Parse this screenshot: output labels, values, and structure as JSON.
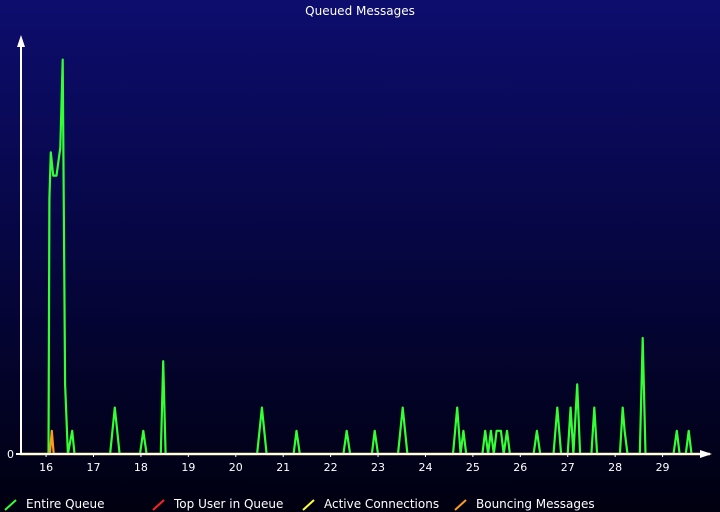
{
  "chart_data": {
    "type": "line",
    "title": "Queued Messages",
    "xlabel": "",
    "ylabel": "",
    "x_ticks": [
      "16",
      "17",
      "18",
      "19",
      "20",
      "21",
      "22",
      "23",
      "24",
      "25",
      "26",
      "27",
      "28",
      "29"
    ],
    "y_ticks": [
      "0"
    ],
    "xlim": [
      15.45,
      30.0
    ],
    "ylim": [
      0,
      17.5
    ],
    "grid": false,
    "legend": "bottom",
    "series": [
      {
        "name": "Entire Queue",
        "color": "#33ff33",
        "points": [
          [
            15.45,
            0
          ],
          [
            16.05,
            0
          ],
          [
            16.07,
            11
          ],
          [
            16.1,
            13
          ],
          [
            16.15,
            12
          ],
          [
            16.22,
            12
          ],
          [
            16.3,
            13.2
          ],
          [
            16.35,
            17
          ],
          [
            16.4,
            3
          ],
          [
            16.46,
            0
          ],
          [
            16.55,
            1
          ],
          [
            16.6,
            0
          ],
          [
            17.35,
            0
          ],
          [
            17.45,
            2
          ],
          [
            17.55,
            0
          ],
          [
            17.98,
            0
          ],
          [
            18.05,
            1
          ],
          [
            18.12,
            0
          ],
          [
            18.42,
            0
          ],
          [
            18.47,
            4
          ],
          [
            18.52,
            0
          ],
          [
            20.45,
            0
          ],
          [
            20.55,
            2
          ],
          [
            20.65,
            0
          ],
          [
            21.22,
            0
          ],
          [
            21.28,
            1
          ],
          [
            21.35,
            0
          ],
          [
            22.27,
            0
          ],
          [
            22.34,
            1
          ],
          [
            22.41,
            0
          ],
          [
            22.87,
            0
          ],
          [
            22.93,
            1
          ],
          [
            23.0,
            0
          ],
          [
            23.42,
            0
          ],
          [
            23.52,
            2
          ],
          [
            23.62,
            0
          ],
          [
            24.58,
            0
          ],
          [
            24.67,
            2
          ],
          [
            24.74,
            0
          ],
          [
            24.8,
            1
          ],
          [
            24.86,
            0
          ],
          [
            25.2,
            0
          ],
          [
            25.26,
            1
          ],
          [
            25.32,
            0
          ],
          [
            25.38,
            1
          ],
          [
            25.44,
            0
          ],
          [
            25.5,
            1
          ],
          [
            25.59,
            1
          ],
          [
            25.65,
            0
          ],
          [
            25.72,
            1
          ],
          [
            25.78,
            0
          ],
          [
            26.28,
            0
          ],
          [
            26.35,
            1
          ],
          [
            26.42,
            0
          ],
          [
            26.7,
            0
          ],
          [
            26.78,
            2
          ],
          [
            26.86,
            0
          ],
          [
            27.0,
            0
          ],
          [
            27.06,
            2
          ],
          [
            27.12,
            0
          ],
          [
            27.2,
            3
          ],
          [
            27.26,
            0
          ],
          [
            27.5,
            0
          ],
          [
            27.56,
            2
          ],
          [
            27.62,
            0
          ],
          [
            28.1,
            0
          ],
          [
            28.16,
            2
          ],
          [
            28.2,
            1
          ],
          [
            28.26,
            0
          ],
          [
            28.52,
            0
          ],
          [
            28.58,
            5
          ],
          [
            28.64,
            0
          ],
          [
            29.23,
            0
          ],
          [
            29.3,
            1
          ],
          [
            29.36,
            0
          ],
          [
            29.49,
            0
          ],
          [
            29.55,
            1
          ],
          [
            29.61,
            0
          ],
          [
            30.0,
            0
          ]
        ]
      },
      {
        "name": "Top User in Queue",
        "color": "#ff2222",
        "points": [
          [
            15.45,
            0
          ],
          [
            30.0,
            0
          ]
        ]
      },
      {
        "name": "Active Connections",
        "color": "#ffff33",
        "points": [
          [
            15.45,
            0
          ],
          [
            30.0,
            0
          ]
        ]
      },
      {
        "name": "Bouncing Messages",
        "color": "#ff9922",
        "points": [
          [
            15.45,
            0
          ],
          [
            16.08,
            0
          ],
          [
            16.12,
            1
          ],
          [
            16.16,
            0
          ],
          [
            30.0,
            0
          ]
        ]
      }
    ]
  }
}
